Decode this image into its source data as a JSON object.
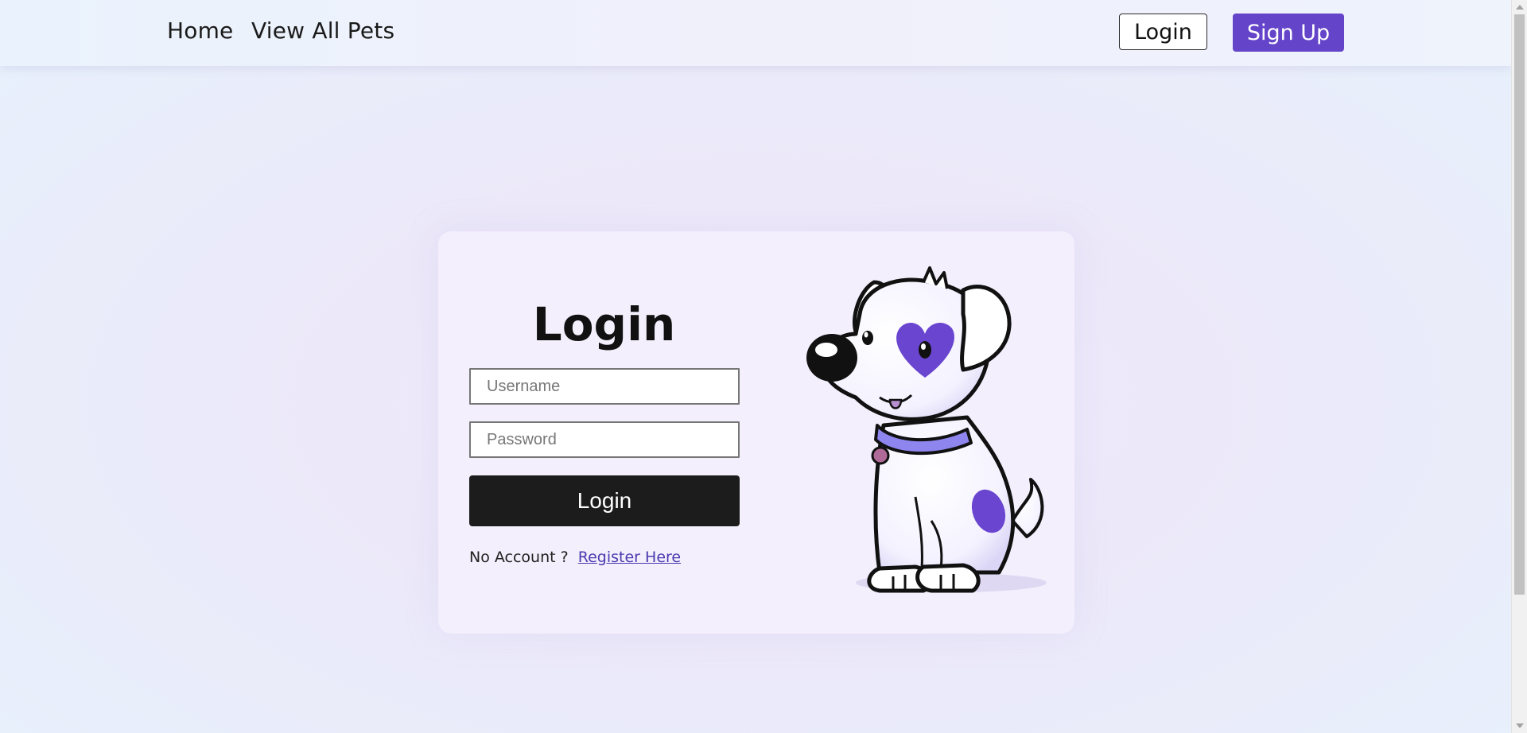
{
  "nav": {
    "home": "Home",
    "view_all_pets": "View All Pets",
    "login": "Login",
    "sign_up": "Sign Up"
  },
  "login_card": {
    "title": "Login",
    "username_placeholder": "Username",
    "password_placeholder": "Password",
    "submit_label": "Login",
    "no_account_text": "No Account ?",
    "register_link": "Register Here",
    "illustration": "dog-illustration"
  },
  "colors": {
    "accent": "#6444c9",
    "submit_bg": "#1c1c1c",
    "link": "#4b3bb0",
    "dog_spots": "#6a45cf"
  }
}
